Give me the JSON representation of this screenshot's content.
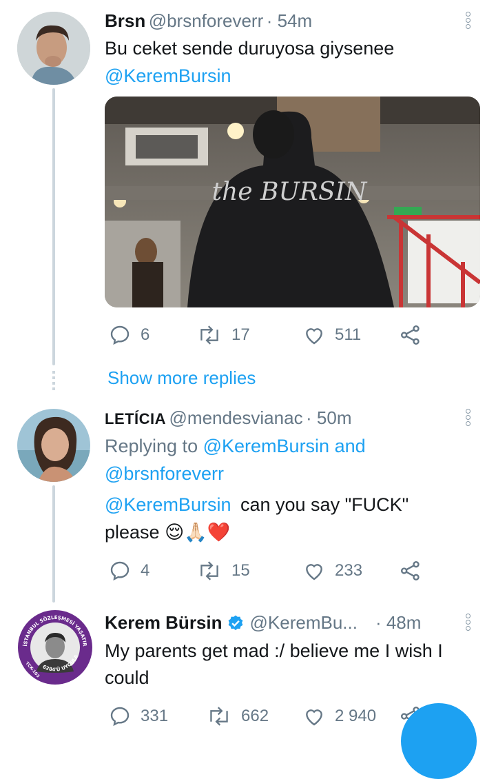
{
  "tweets": [
    {
      "name": "Brsn",
      "handle": "@brsnforeverr",
      "time": "· 54m",
      "text": "Bu ceket sende duruyosa giysenee",
      "mention": "@KeremBursin",
      "media_text": "the BURSIN",
      "replies": "6",
      "retweets": "17",
      "likes": "511"
    },
    {
      "name": "LETÍCIA",
      "handle": "@mendesvianac",
      "time": "· 50m",
      "replying_prefix": "Replying to",
      "replying_a": "@KeremBursin",
      "replying_and": "and",
      "replying_b": "@brsnforeverr",
      "mention": "@KeremBursin",
      "text_a": "can you say \"FUCK\"",
      "text_b": "please",
      "emojis": "😌🙏🏻❤️",
      "replies": "4",
      "retweets": "15",
      "likes": "233"
    },
    {
      "name": "Kerem Bürsin",
      "handle": "@KeremBu...",
      "time": "· 48m",
      "verified": true,
      "text_a": "My parents get mad :/ believe me I wish I",
      "text_b": "could",
      "replies": "331",
      "retweets": "662",
      "likes": "2 940",
      "avatar_ring_text": "İSTANBUL SÖZLEŞMESİ YAŞATIR",
      "avatar_bottom_text": "6284'Ü UYGULA",
      "avatar_left_text": "TCK-103"
    }
  ],
  "show_more_replies": "Show more replies",
  "colors": {
    "accent": "#1da1f2",
    "muted": "#657786",
    "line": "#ccd6dd",
    "ring": "#6a2b8c"
  }
}
